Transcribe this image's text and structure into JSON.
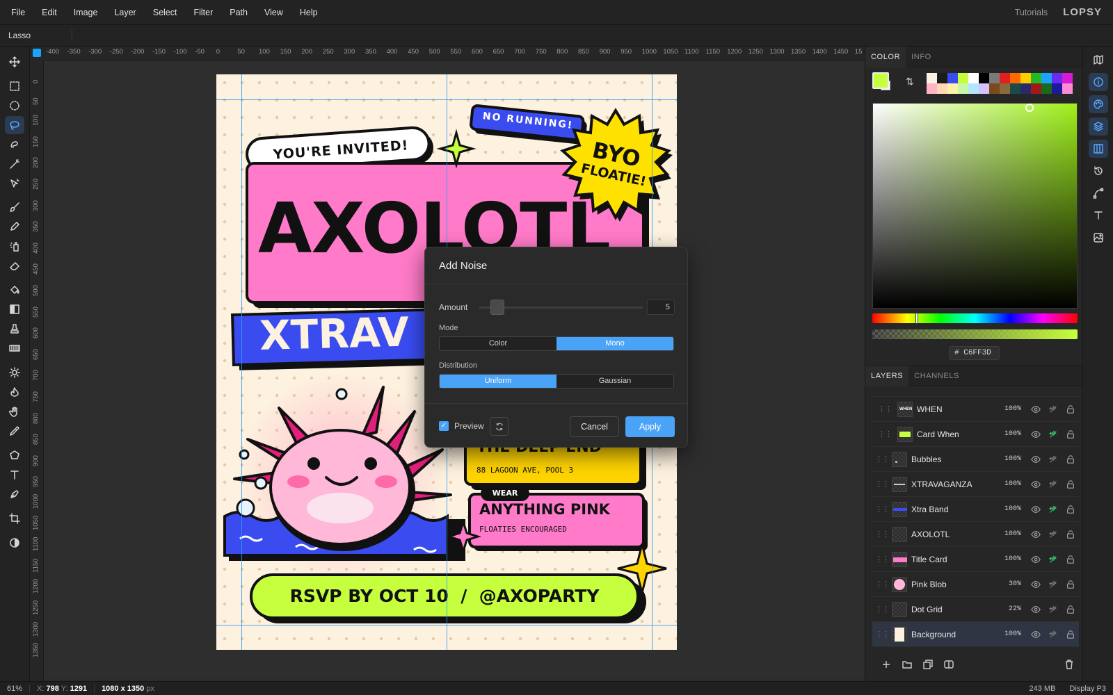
{
  "menu": [
    "File",
    "Edit",
    "Image",
    "Layer",
    "Select",
    "Filter",
    "Path",
    "View",
    "Help"
  ],
  "header": {
    "tutorials": "Tutorials",
    "logo": "LOPSY"
  },
  "options": {
    "tool_name": "Lasso"
  },
  "rulers": {
    "h": [
      "-400",
      "-350",
      "-300",
      "-250",
      "-200",
      "-150",
      "-100",
      "-50",
      "0",
      "50",
      "100",
      "150",
      "200",
      "250",
      "300",
      "350",
      "400",
      "450",
      "500",
      "550",
      "600",
      "650",
      "700",
      "750",
      "800",
      "850",
      "900",
      "950",
      "1000",
      "1050",
      "1100",
      "1150",
      "1200",
      "1250",
      "1300",
      "1350",
      "1400",
      "1450",
      "15"
    ],
    "v": [
      "0",
      "50",
      "100",
      "150",
      "200",
      "250",
      "300",
      "350",
      "400",
      "450",
      "500",
      "550",
      "600",
      "650",
      "700",
      "750",
      "800",
      "850",
      "900",
      "950",
      "1000",
      "1050",
      "1100",
      "1150",
      "1200",
      "1250",
      "1300",
      "1350"
    ]
  },
  "poster": {
    "invited": "YOU'RE INVITED!",
    "no_running": "NO RUNNING!",
    "byo1": "BYO",
    "byo2": "FLOATIE!",
    "title": "AXOLOTL",
    "band": "XTRAV",
    "deep_end": "THE DEEP END",
    "address": "88 LAGOON AVE, POOL 3",
    "wear": "WEAR",
    "pink": "ANYTHING PINK",
    "floaties": "FLOATIES ENCOURAGED",
    "rsvp": "RSVP BY OCT 10  /  @AXOPARTY"
  },
  "dialog": {
    "title": "Add Noise",
    "amount_label": "Amount",
    "amount_value": "5",
    "amount_fraction": 0.05,
    "mode_label": "Mode",
    "mode_options": [
      "Color",
      "Mono"
    ],
    "mode_selected": "Mono",
    "dist_label": "Distribution",
    "dist_options": [
      "Uniform",
      "Gaussian"
    ],
    "dist_selected": "Uniform",
    "preview_label": "Preview",
    "preview_checked": true,
    "cancel": "Cancel",
    "apply": "Apply"
  },
  "color_panel": {
    "tabs": [
      "COLOR",
      "INFO"
    ],
    "active_tab": "COLOR",
    "foreground": "#C6FF3D",
    "background": "#FFFFFF",
    "hex_prefix": "#",
    "hex": "C6FF3D",
    "palette": [
      "#fdf1df",
      "#1c1c1c",
      "#3a4cf0",
      "#c6ff3d",
      "#ffffff",
      "#000000",
      "#7a7a7a",
      "#e21f1f",
      "#ff6a00",
      "#ffcc00",
      "#22bb22",
      "#1aa3ff",
      "#6a2cf0",
      "#d61ad6",
      "#ffb3c7",
      "#ffd8b3",
      "#fff3a8",
      "#c8f7a8",
      "#b3e5ff",
      "#d4c2ff",
      "#7a4a1a",
      "#8a6a3a",
      "#1a4a4a",
      "#2a2a6a",
      "#a01a1a",
      "#1a6a1a",
      "#1a1a9a",
      "#ff8ad8"
    ]
  },
  "layers_panel": {
    "tabs": [
      "LAYERS",
      "CHANNELS"
    ],
    "active_tab": "LAYERS",
    "items": [
      {
        "name": "WHEN",
        "opacity": "100%",
        "indent": true,
        "fx": false,
        "thumb": "when"
      },
      {
        "name": "Card When",
        "opacity": "100%",
        "indent": true,
        "fx": true,
        "thumb": "card"
      },
      {
        "name": "Bubbles",
        "opacity": "100%",
        "indent": false,
        "fx": false,
        "thumb": "bubbles"
      },
      {
        "name": "XTRAVAGANZA",
        "opacity": "100%",
        "indent": false,
        "fx": false,
        "thumb": "text"
      },
      {
        "name": "Xtra Band",
        "opacity": "100%",
        "indent": false,
        "fx": true,
        "thumb": "band"
      },
      {
        "name": "AXOLOTL",
        "opacity": "100%",
        "indent": false,
        "fx": false,
        "thumb": "axo"
      },
      {
        "name": "Title Card",
        "opacity": "100%",
        "indent": false,
        "fx": true,
        "thumb": "title"
      },
      {
        "name": "Pink Blob",
        "opacity": "30%",
        "indent": false,
        "fx": false,
        "thumb": "blob"
      },
      {
        "name": "Dot Grid",
        "opacity": "22%",
        "indent": false,
        "fx": false,
        "thumb": "dots"
      },
      {
        "name": "Background",
        "opacity": "100%",
        "indent": false,
        "fx": false,
        "thumb": "bg",
        "selected": true
      }
    ]
  },
  "status": {
    "zoom": "61%",
    "x_label": "X:",
    "x": "798",
    "y_label": "Y:",
    "y": "1291",
    "size": "1080 x 1350",
    "unit": "px",
    "memory": "243 MB",
    "profile": "Display P3"
  }
}
